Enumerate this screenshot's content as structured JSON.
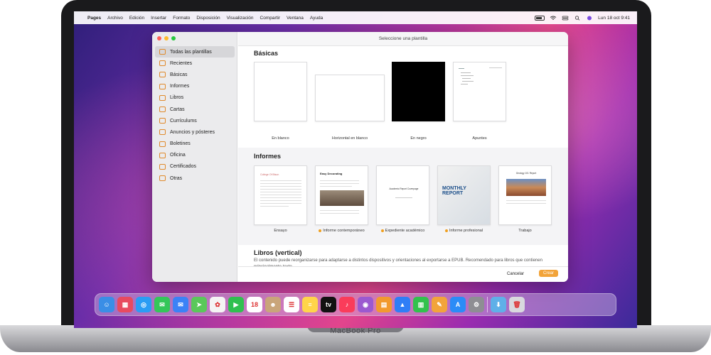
{
  "menubar": {
    "apple_icon": "apple-icon",
    "items": [
      "Pages",
      "Archivo",
      "Edición",
      "Insertar",
      "Formato",
      "Disposición",
      "Visualización",
      "Compartir",
      "Ventana",
      "Ayuda"
    ],
    "clock": "Lun 18 oct 9:41"
  },
  "window": {
    "title": "Seleccione una plantilla",
    "sidebar": [
      {
        "label": "Todas las plantillas",
        "icon": "grid-icon"
      },
      {
        "label": "Recientes",
        "icon": "clock-icon"
      },
      {
        "label": "Básicas",
        "icon": "document-icon"
      },
      {
        "label": "Informes",
        "icon": "layers-icon"
      },
      {
        "label": "Libros",
        "icon": "book-icon"
      },
      {
        "label": "Cartas",
        "icon": "envelope-icon"
      },
      {
        "label": "Currículums",
        "icon": "resume-icon"
      },
      {
        "label": "Anuncios y pósteres",
        "icon": "poster-icon"
      },
      {
        "label": "Boletines",
        "icon": "newsletter-icon"
      },
      {
        "label": "Oficina",
        "icon": "person-icon"
      },
      {
        "label": "Certificados",
        "icon": "certificate-icon"
      },
      {
        "label": "Otras",
        "icon": "other-icon"
      }
    ],
    "basicas": {
      "title": "Básicas",
      "templates": [
        "En blanco",
        "Horizontal en blanco",
        "En negro",
        "Apuntes"
      ]
    },
    "informes": {
      "title": "Informes",
      "templates": [
        {
          "name": "Ensayo",
          "tile_title": "College Of Bison",
          "dot": false
        },
        {
          "name": "Informe contemporáneo",
          "tile_title": "Easy Decorating",
          "dot": true
        },
        {
          "name": "Expediente académico",
          "tile_title": "Academic Report Coverpage",
          "dot": true
        },
        {
          "name": "Informe profesional",
          "tile_title": "MONTHLY REPORT",
          "dot": true
        },
        {
          "name": "Trabajo",
          "tile_title": "Geology 101 Report",
          "dot": false
        }
      ]
    },
    "libros": {
      "title": "Libros (vertical)",
      "description": "El contenido puede reorganizarse para adaptarse a distintos dispositivos y orientaciones al exportarse a EPUB. Recomendado para libros que contienen principalmente texto."
    },
    "footer": {
      "cancel": "Cancelar",
      "create": "Crear"
    }
  },
  "dock": {
    "apps": [
      {
        "name": "finder",
        "color": "#3a8ee6",
        "glyph": "☺"
      },
      {
        "name": "launchpad",
        "color": "#e84a5f",
        "glyph": "▦"
      },
      {
        "name": "safari",
        "color": "#2a9df4",
        "glyph": "◎"
      },
      {
        "name": "messages",
        "color": "#34c759",
        "glyph": "✉"
      },
      {
        "name": "mail",
        "color": "#3b82f6",
        "glyph": "✉"
      },
      {
        "name": "maps",
        "color": "#5ac85a",
        "glyph": "➤"
      },
      {
        "name": "photos",
        "color": "#f4f4f4",
        "glyph": "✿"
      },
      {
        "name": "facetime",
        "color": "#30c04f",
        "glyph": "▶"
      },
      {
        "name": "calendar",
        "color": "#ffffff",
        "glyph": "18"
      },
      {
        "name": "contacts",
        "color": "#c9a57a",
        "glyph": "☻"
      },
      {
        "name": "reminders",
        "color": "#ffffff",
        "glyph": "☰"
      },
      {
        "name": "notes",
        "color": "#ffd54a",
        "glyph": "≡"
      },
      {
        "name": "tv",
        "color": "#111111",
        "glyph": "tv"
      },
      {
        "name": "music",
        "color": "#fa3c5a",
        "glyph": "♪"
      },
      {
        "name": "podcasts",
        "color": "#9b59d0",
        "glyph": "◉"
      },
      {
        "name": "books",
        "color": "#f29a2e",
        "glyph": "▤"
      },
      {
        "name": "keynote",
        "color": "#2f7ef6",
        "glyph": "▲"
      },
      {
        "name": "numbers",
        "color": "#32c24d",
        "glyph": "▥"
      },
      {
        "name": "pages",
        "color": "#f2a43a",
        "glyph": "✎"
      },
      {
        "name": "app-store",
        "color": "#2b8cf7",
        "glyph": "A"
      },
      {
        "name": "system-preferences",
        "color": "#8e8e93",
        "glyph": "⚙"
      },
      {
        "name": "downloads-folder",
        "color": "#5fb0e8",
        "glyph": "⬇"
      },
      {
        "name": "trash",
        "color": "#d9d9de",
        "glyph": "🗑"
      }
    ]
  },
  "device": {
    "brand": "MacBook Pro"
  },
  "colors": {
    "accent": "#f2a43a",
    "sidebar_icon": "#e08a2b"
  }
}
